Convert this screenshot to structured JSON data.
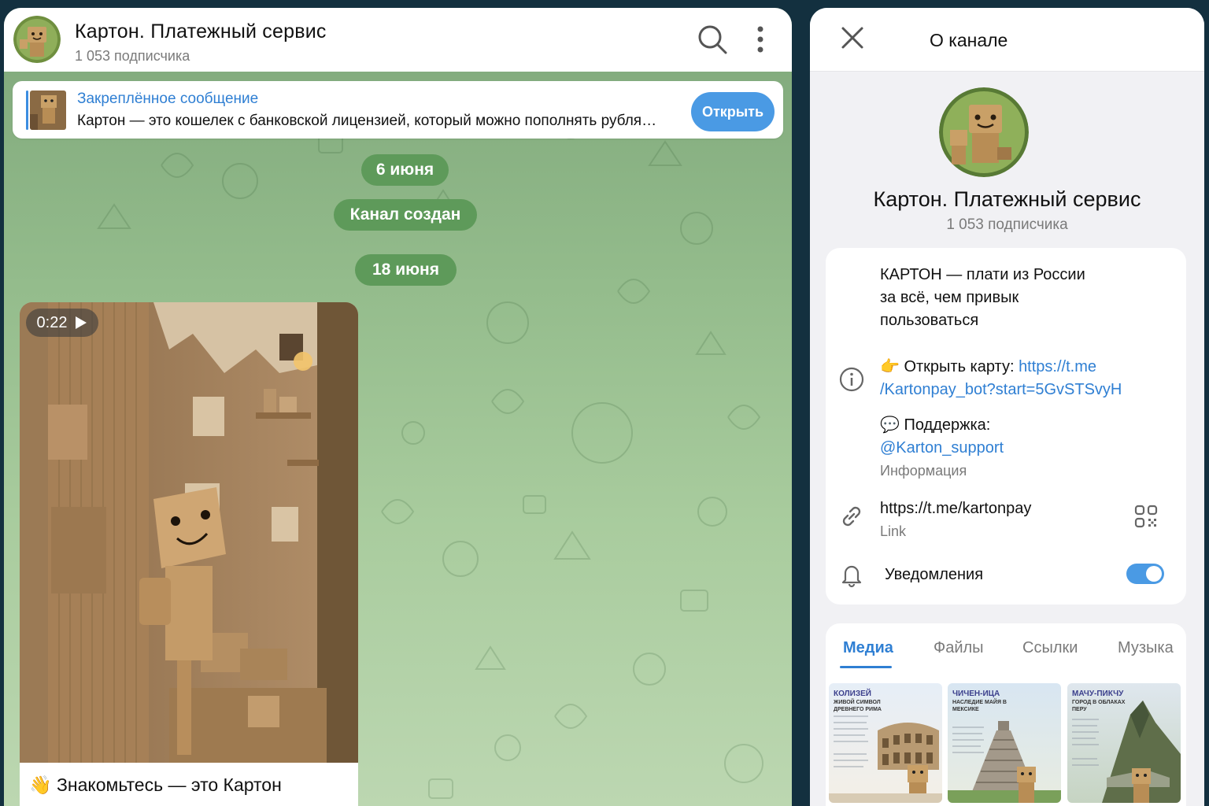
{
  "chat": {
    "title": "Картон. Платежный сервис",
    "subscribers": "1 053 подписчика",
    "icons": {
      "search": "search-icon",
      "menu": "more-vertical-icon"
    },
    "pinned": {
      "title": "Закреплённое сообщение",
      "text": "Картон — это кошелек с банковской лицензией, который можно пополнять рубля…",
      "button": "Открыть"
    },
    "date_1": "6 июня",
    "service_message": "Канал создан",
    "date_2": "18 июня",
    "message": {
      "duration": "0:22",
      "caption": "👋 Знакомьтесь — это Картон"
    }
  },
  "info": {
    "panel_title": "О канале",
    "name": "Картон. Платежный сервис",
    "subscribers": "1 053 подписчика",
    "description_1": "КАРТОН — плати из России",
    "description_2": "за всё, чем привык",
    "description_3": "пользоваться",
    "open_card_label": "👉 Открыть карту: ",
    "open_card_link_1": "https://t.me",
    "open_card_link_2": "/Kartonpay_bot?start=5GvSTSvyH",
    "support_label": "💬 Поддержка:",
    "support_link": "@Karton_support",
    "info_caption": "Информация",
    "channel_link": "https://t.me/kartonpay",
    "link_caption": "Link",
    "notifications": "Уведомления",
    "notifications_enabled": true,
    "tabs": [
      "Медиа",
      "Файлы",
      "Ссылки",
      "Музыка"
    ],
    "active_tab": 0,
    "media": [
      {
        "title": "КОЛИЗЕЙ",
        "subtitle": "ЖИВОЙ СИМВОЛ ДРЕВНЕГО РИМА"
      },
      {
        "title": "ЧИЧЕН-ИЦА",
        "subtitle": "НАСЛЕДИЕ МАЙЯ В МЕКСИКЕ"
      },
      {
        "title": "МАЧУ-ПИКЧУ",
        "subtitle": "ГОРОД В ОБЛАКАХ ПЕРУ"
      }
    ]
  },
  "colors": {
    "accent": "#2f7fd3",
    "button": "#4a9ae4",
    "pill": "#5e9a5a",
    "chat_bg": "#94bc8c"
  }
}
